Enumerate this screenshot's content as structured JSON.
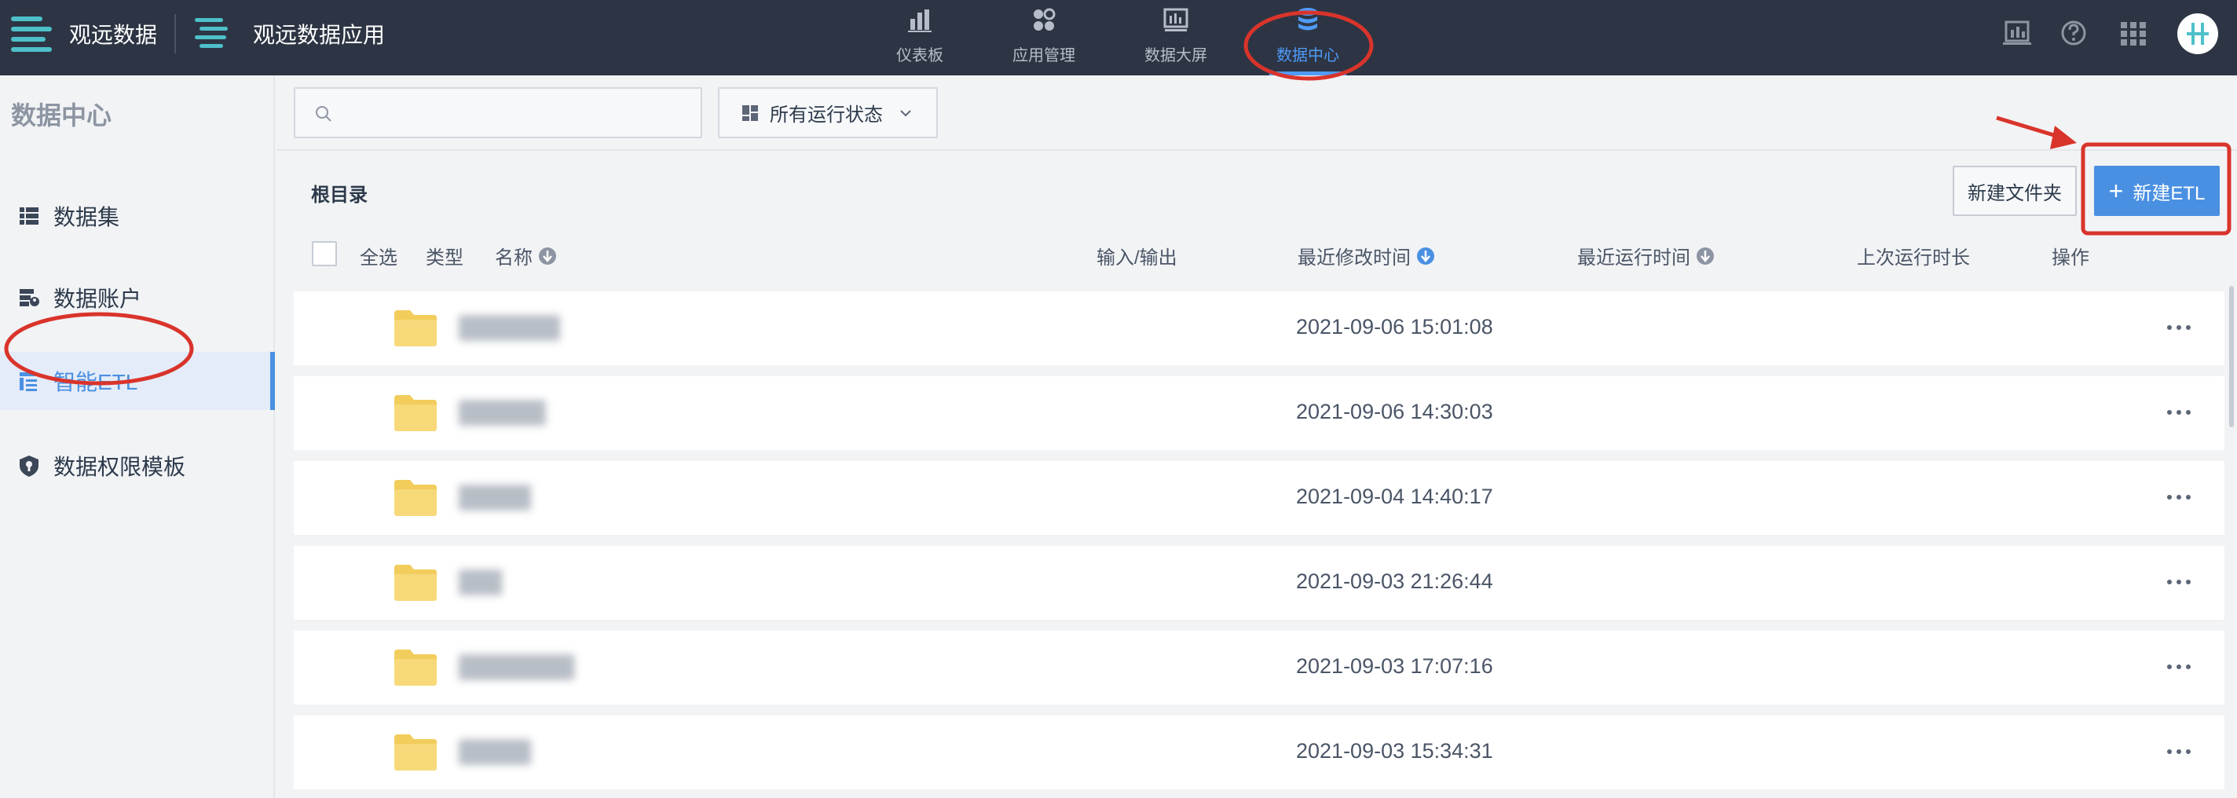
{
  "topbar": {
    "brand_name": "观远数据",
    "app_name": "观远数据应用",
    "nav": [
      {
        "label": "仪表板",
        "icon": "bar-chart-icon"
      },
      {
        "label": "应用管理",
        "icon": "apps-icon"
      },
      {
        "label": "数据大屏",
        "icon": "screen-icon"
      },
      {
        "label": "数据中心",
        "icon": "database-icon",
        "active": true
      }
    ],
    "right_icons": [
      "monitor-icon",
      "help-icon",
      "grid-menu-icon",
      "avatar"
    ]
  },
  "sidebar": {
    "title": "数据中心",
    "items": [
      {
        "label": "数据集",
        "icon": "dataset-icon"
      },
      {
        "label": "数据账户",
        "icon": "data-account-icon"
      },
      {
        "label": "智能ETL",
        "icon": "etl-icon",
        "active": true
      },
      {
        "label": "数据权限模板",
        "icon": "shield-icon"
      }
    ]
  },
  "filters": {
    "search_placeholder": "",
    "status_dropdown": "所有运行状态"
  },
  "content": {
    "breadcrumb": "根目录",
    "new_folder_label": "新建文件夹",
    "new_etl_label": "新建ETL",
    "columns": {
      "select_all": "全选",
      "type": "类型",
      "name": "名称",
      "io": "输入/输出",
      "modified": "最近修改时间",
      "last_run": "最近运行时间",
      "duration": "上次运行时长",
      "actions": "操作"
    },
    "rows": [
      {
        "name": "███████",
        "modified": "2021-09-06 15:01:08"
      },
      {
        "name": "██████",
        "modified": "2021-09-06 14:30:03"
      },
      {
        "name": "█████",
        "modified": "2021-09-04 14:40:17"
      },
      {
        "name": "███",
        "modified": "2021-09-03 21:26:44"
      },
      {
        "name": "████████",
        "modified": "2021-09-03 17:07:16"
      },
      {
        "name": "█████",
        "modified": "2021-09-03 15:34:31"
      }
    ]
  },
  "colors": {
    "topbar_bg": "#2d3544",
    "accent": "#4a90e2",
    "annotation_red": "#d9342b",
    "folder_yellow": "#f2cd5c"
  }
}
